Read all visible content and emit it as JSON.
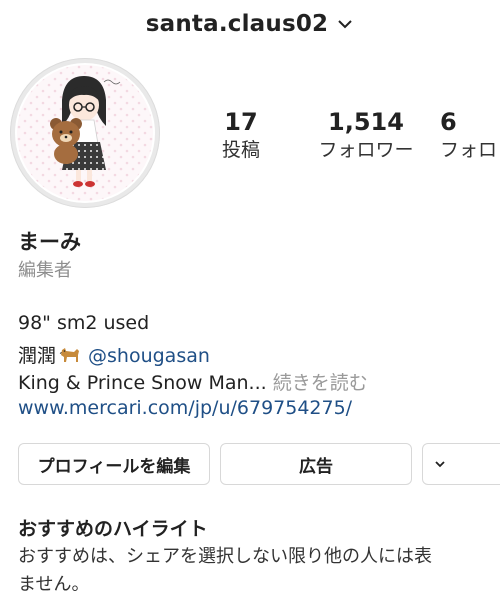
{
  "header": {
    "username": "santa.claus02",
    "dropdown_icon": "chevron-down-icon"
  },
  "stats": [
    {
      "value": "17",
      "label": "投稿"
    },
    {
      "value": "1,514",
      "label": "フォロワー"
    },
    {
      "value": "6",
      "label": "フォロ"
    }
  ],
  "profile": {
    "name": "まーみ",
    "category": "編集者",
    "bio": {
      "line1": "98\" sm2 used",
      "line2_prefix": "潤潤",
      "line2_mention": "@shougasan",
      "line3_text": "King & Prince Snow Man...",
      "line3_more": "続きを読む",
      "link": "www.mercari.com/jp/u/679754275/"
    }
  },
  "buttons": {
    "edit_profile": "プロフィールを編集",
    "ad": "広告",
    "more_icon": "person-add-icon"
  },
  "highlights": {
    "title": "おすすめのハイライト",
    "desc_line1": "おすすめは、シェアを選択しない限り他の人には表",
    "desc_line2": "ません。"
  }
}
